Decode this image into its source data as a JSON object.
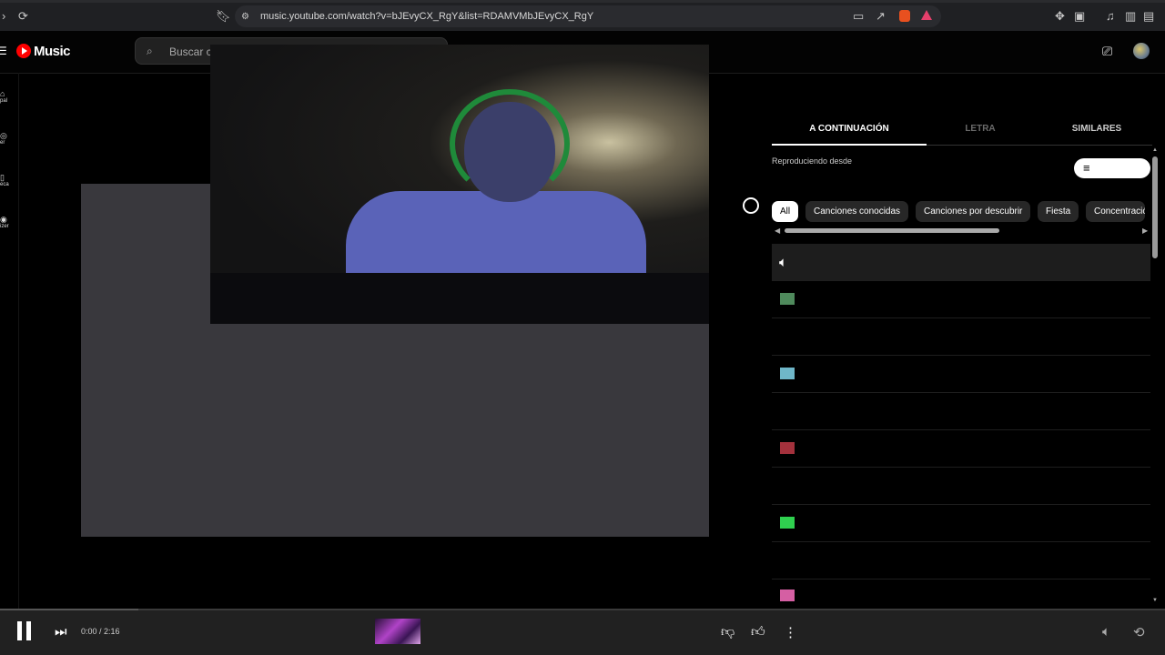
{
  "browser": {
    "url": "music.youtube.com/watch?v=bJEvyCX_RgY&list=RDAMVMbJEvyCX_RgY",
    "icons": [
      "reload-icon",
      "bookmark-icon",
      "site-info-icon",
      "cast-screen-icon",
      "share-icon",
      "brave-shield-icon",
      "rewards-icon",
      "extensions-icon",
      "wallet-icon",
      "media-icon",
      "sidebar-icon",
      "wallet-alt-icon"
    ]
  },
  "header": {
    "logo_text": "Music",
    "search_placeholder": "Buscar c"
  },
  "sidebar": {
    "items": [
      {
        "label": "pal"
      },
      {
        "label": "er"
      },
      {
        "label": "eca"
      },
      {
        "label": "izer"
      }
    ]
  },
  "panel": {
    "tabs": [
      {
        "label": "A CONTINUACIÓN",
        "selected": true
      },
      {
        "label": "LETRA",
        "selected": false
      },
      {
        "label": "SIMILARES",
        "selected": false
      }
    ],
    "playing_from": "Reproduciendo desde",
    "chips": [
      {
        "label": "All",
        "selected": true
      },
      {
        "label": "Canciones conocidas",
        "selected": false
      },
      {
        "label": "Canciones por descubrir",
        "selected": false
      },
      {
        "label": "Fiesta",
        "selected": false
      },
      {
        "label": "Concentració",
        "selected": false
      }
    ],
    "queue_thumb_colors": [
      "#4f8a5c",
      "#6fb7c9",
      "#a3313c",
      "#2fd04f",
      "#d55fa3"
    ]
  },
  "player": {
    "time": "0:00 / 2:16",
    "progress_fraction": 0.0
  },
  "colors": {
    "accent": "#ff0000",
    "background": "#030303",
    "player_bar": "#212121"
  }
}
